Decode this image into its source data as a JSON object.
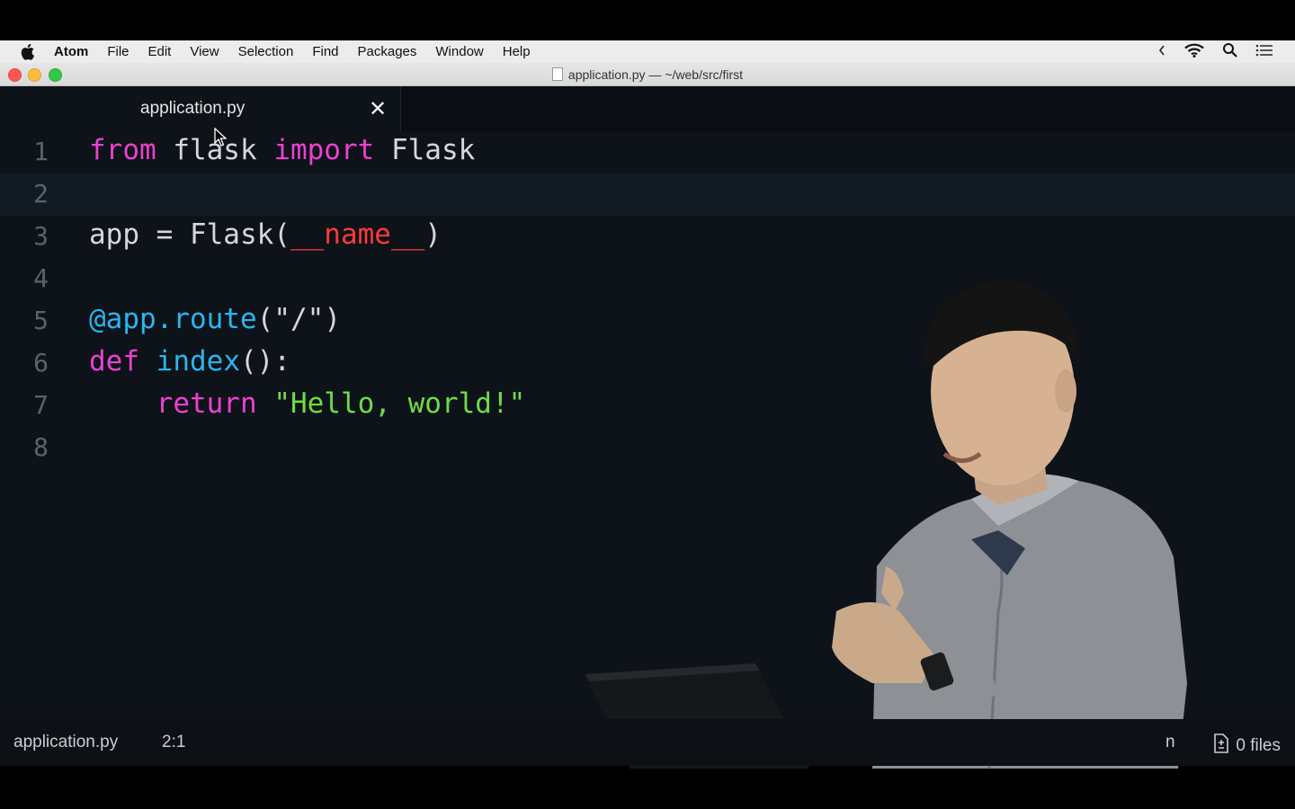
{
  "menubar": {
    "app": "Atom",
    "items": [
      "File",
      "Edit",
      "View",
      "Selection",
      "Find",
      "Packages",
      "Window",
      "Help"
    ]
  },
  "window": {
    "title": "application.py — ~/web/src/first"
  },
  "tab": {
    "title": "application.py",
    "close": "✕"
  },
  "editor": {
    "line_numbers": [
      "1",
      "2",
      "3",
      "4",
      "5",
      "6",
      "7",
      "8"
    ],
    "current_line": 2,
    "lines": [
      [
        {
          "t": "from",
          "c": "kw"
        },
        {
          "t": " flask ",
          "c": "plain"
        },
        {
          "t": "import",
          "c": "kw"
        },
        {
          "t": " Flask",
          "c": "plain"
        }
      ],
      [],
      [
        {
          "t": "app = Flask(",
          "c": "plain"
        },
        {
          "t": "__name__",
          "c": "dunder"
        },
        {
          "t": ")",
          "c": "plain"
        }
      ],
      [],
      [
        {
          "t": "@app.route",
          "c": "fn"
        },
        {
          "t": "(",
          "c": "plain"
        },
        {
          "t": "\"/\"",
          "c": "plain"
        },
        {
          "t": ")",
          "c": "plain"
        }
      ],
      [
        {
          "t": "def",
          "c": "kw"
        },
        {
          "t": " ",
          "c": "plain"
        },
        {
          "t": "index",
          "c": "fn"
        },
        {
          "t": "():",
          "c": "plain"
        }
      ],
      [
        {
          "t": "    ",
          "c": "plain"
        },
        {
          "t": "return",
          "c": "kw"
        },
        {
          "t": " ",
          "c": "plain"
        },
        {
          "t": "\"Hello, world!\"",
          "c": "str"
        }
      ],
      []
    ]
  },
  "status": {
    "file": "application.py",
    "cursor_position": "2:1",
    "partial": "n",
    "files": "0 files"
  },
  "colors": {
    "keyword": "#ee3fd2",
    "function": "#2ab5f0",
    "string": "#6fdc4a",
    "dunder": "#ff3a3a",
    "editor_bg": "#0d1318"
  }
}
